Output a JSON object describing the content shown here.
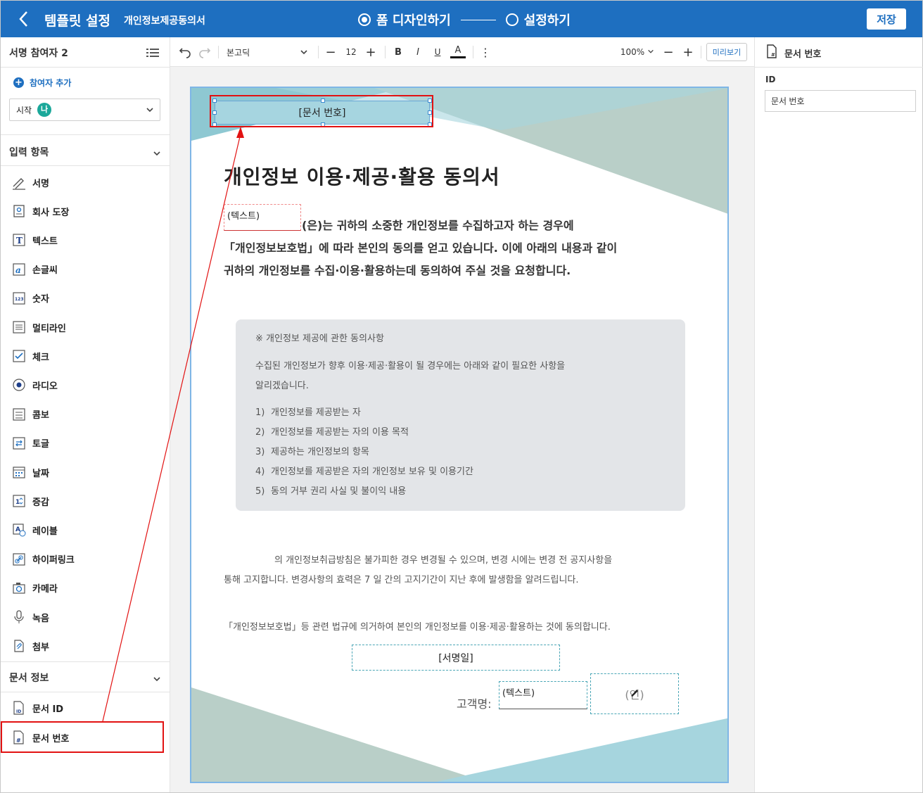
{
  "header": {
    "title": "템플릿 설정",
    "document_name": "개인정보제공동의서",
    "step_design": "폼 디자인하기",
    "step_settings": "설정하기",
    "save_label": "저장"
  },
  "left_panel": {
    "participants_title": "서명 참여자 2",
    "add_participant": "참여자 추가",
    "participant_select_label": "시작",
    "participant_avatar": "나",
    "input_section_title": "입력 항목",
    "input_items": [
      {
        "label": "서명",
        "icon": "signature-icon"
      },
      {
        "label": "회사 도장",
        "icon": "company-stamp-icon"
      },
      {
        "label": "텍스트",
        "icon": "text-icon"
      },
      {
        "label": "손글씨",
        "icon": "handwriting-icon"
      },
      {
        "label": "숫자",
        "icon": "number-icon"
      },
      {
        "label": "멀티라인",
        "icon": "multiline-icon"
      },
      {
        "label": "체크",
        "icon": "checkbox-icon"
      },
      {
        "label": "라디오",
        "icon": "radio-icon"
      },
      {
        "label": "콤보",
        "icon": "combo-icon"
      },
      {
        "label": "토글",
        "icon": "toggle-icon"
      },
      {
        "label": "날짜",
        "icon": "calendar-icon"
      },
      {
        "label": "증감",
        "icon": "stepper-icon"
      },
      {
        "label": "레이블",
        "icon": "label-icon"
      },
      {
        "label": "하이퍼링크",
        "icon": "hyperlink-icon"
      },
      {
        "label": "카메라",
        "icon": "camera-icon"
      },
      {
        "label": "녹음",
        "icon": "microphone-icon"
      },
      {
        "label": "첨부",
        "icon": "attachment-icon"
      }
    ],
    "doc_info_title": "문서 정보",
    "doc_info_items": [
      {
        "label": "문서 ID",
        "icon": "document-id-icon"
      },
      {
        "label": "문서 번호",
        "icon": "document-number-icon"
      }
    ]
  },
  "toolbar": {
    "font": "본고딕",
    "font_size": "12",
    "bold": "B",
    "italic": "I",
    "underline": "U",
    "font_color": "A",
    "zoom": "100%",
    "preview": "미리보기"
  },
  "document": {
    "doc_number_field": "[문서 번호]",
    "title": "개인정보 이용·제공·활용 동의서",
    "text_field": "(텍스트)",
    "intro_line1": "(은)는 귀하의 소중한 개인정보를 수집하고자 하는 경우에",
    "intro_line2": "「개인정보보호법」에 따라 본인의 동의를 얻고 있습니다. 이에 아래의 내용과 같이",
    "intro_line3": "귀하의 개인정보를 수집·이용·활용하는데 동의하여 주실 것을 요청합니다.",
    "box_heading": "※ 개인정보 제공에 관한 동의사항",
    "box_desc1": "수집된 개인정보가 향후 이용·제공·활용이 될 경우에는 아래와 같이 필요한 사항을",
    "box_desc2": "알리겠습니다.",
    "box_items": [
      {
        "num": "1)",
        "text": "개인정보를 제공받는 자"
      },
      {
        "num": "2)",
        "text": "개인정보를 제공받는 자의 이용 목적"
      },
      {
        "num": "3)",
        "text": "제공하는 개인정보의 항목"
      },
      {
        "num": "4)",
        "text": "개인정보를 제공받은 자의 개인정보 보유 및 이용기간"
      },
      {
        "num": "5)",
        "text": "동의 거부 권리 사실 및 불이익 내용"
      }
    ],
    "policy_line1": "의 개인정보취급방침은 불가피한 경우 변경될 수 있으며, 변경 시에는 변경 전 공지사항을",
    "policy_line2": "통해 고지합니다. 변경사항의 효력은 7 일 간의 고지기간이 지난 후에 발생함을 알려드립니다.",
    "consent_line": "「개인정보보호법」등 관련 법규에 의거하여 본인의 개인정보를 이용·제공·활용하는 것에 동의합니다.",
    "sign_date_field": "[서명일]",
    "customer_label": "고객명:",
    "customer_field": "(텍스트)",
    "stamp_field": "(인)"
  },
  "right_panel": {
    "title": "문서 번호",
    "id_label": "ID",
    "id_value": "문서 번호"
  },
  "colors": {
    "header_bg": "#1e6fc0",
    "highlight": "#e21212",
    "field_bg": "#a6d5e0",
    "decor_teal": "#8ec8d2",
    "decor_sage": "#b9cfc8"
  }
}
